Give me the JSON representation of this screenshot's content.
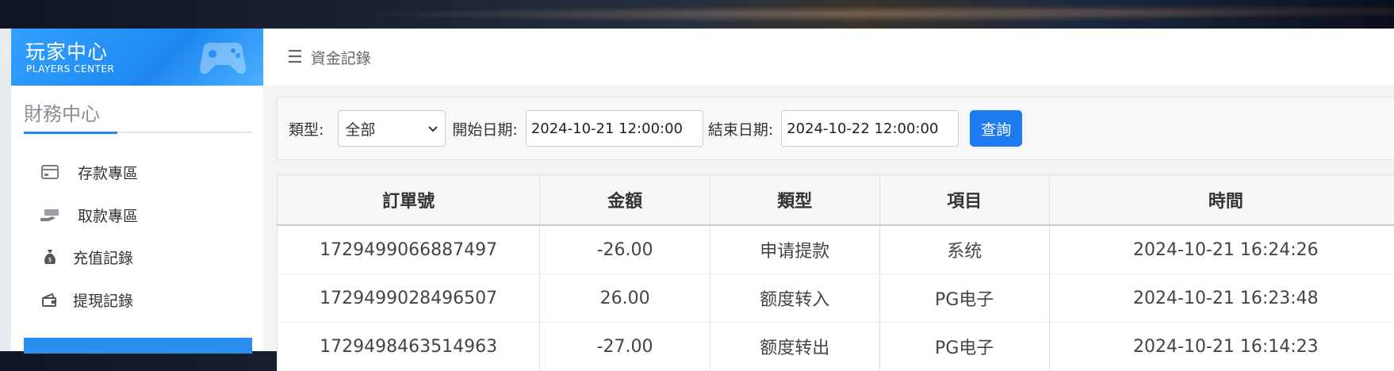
{
  "sidebar": {
    "logo_title": "玩家中心",
    "logo_subtitle": "PLAYERS CENTER",
    "section_title": "財務中心",
    "items": [
      {
        "label": "存款專區",
        "icon": "card-icon"
      },
      {
        "label": "取款專區",
        "icon": "cash-hand-icon"
      },
      {
        "label": "充值記錄",
        "icon": "money-bag-icon"
      },
      {
        "label": "提現記錄",
        "icon": "wallet-icon"
      }
    ]
  },
  "header": {
    "title": "資金記錄",
    "menu_icon": "menu-icon"
  },
  "filter": {
    "type_label": "類型:",
    "type_value": "全部",
    "start_label": "開始日期:",
    "start_value": "2024-10-21 12:00:00",
    "end_label": "結束日期:",
    "end_value": "2024-10-22 12:00:00",
    "search_button": "查詢"
  },
  "table": {
    "columns": [
      "訂單號",
      "金額",
      "類型",
      "項目",
      "時間"
    ],
    "rows": [
      [
        "1729499066887497",
        "-26.00",
        "申请提款",
        "系统",
        "2024-10-21 16:24:26"
      ],
      [
        "1729499028496507",
        "26.00",
        "额度转入",
        "PG电子",
        "2024-10-21 16:23:48"
      ],
      [
        "1729498463514963",
        "-27.00",
        "额度转出",
        "PG电子",
        "2024-10-21 16:14:23"
      ]
    ]
  },
  "colors": {
    "accent": "#1e7cf0",
    "logo_bg": "#1e88f0"
  }
}
